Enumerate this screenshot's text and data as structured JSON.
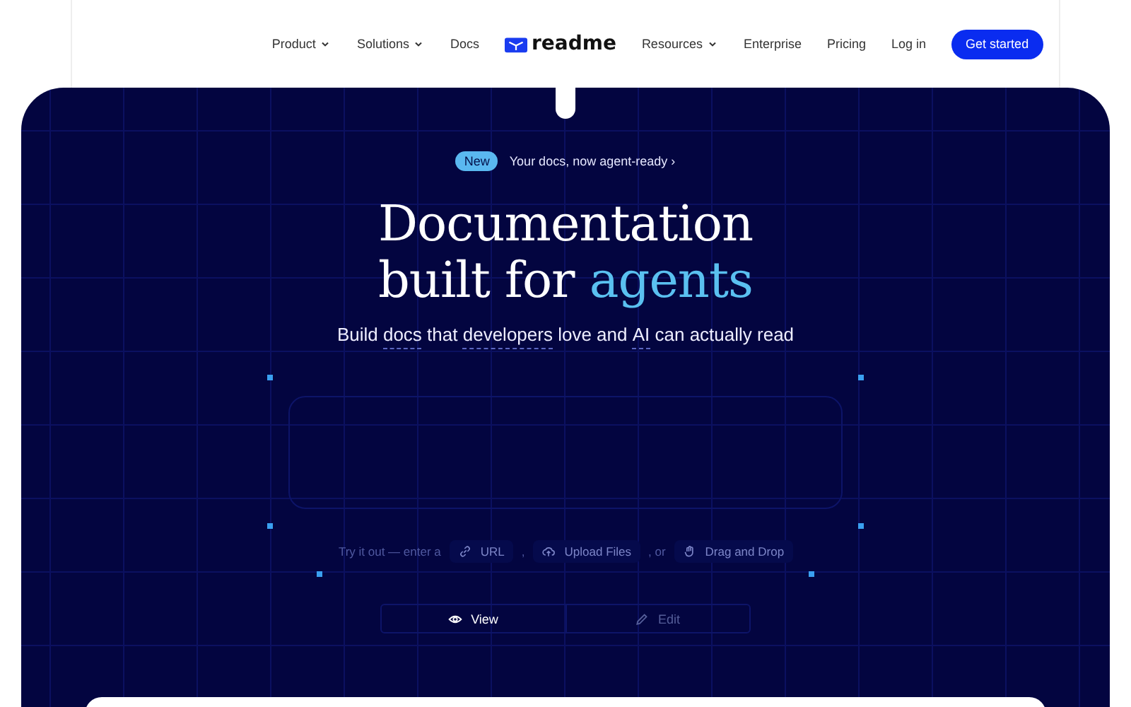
{
  "nav": {
    "left": [
      {
        "label": "Product",
        "dropdown": true
      },
      {
        "label": "Solutions",
        "dropdown": true
      },
      {
        "label": "Docs",
        "dropdown": false
      }
    ],
    "logo": "readme",
    "right": [
      {
        "label": "Resources",
        "dropdown": true
      },
      {
        "label": "Enterprise",
        "dropdown": false
      },
      {
        "label": "Pricing",
        "dropdown": false
      }
    ],
    "login": "Log in",
    "cta": "Get started"
  },
  "hero": {
    "badge": "New",
    "announcement": "Your docs, now agent-ready ›",
    "title_line1": "Documentation",
    "title_line2": "built for",
    "title_accent": "agents",
    "subtitle": [
      {
        "text": "Build ",
        "underlined": false
      },
      {
        "text": "docs",
        "underlined": true
      },
      {
        "text": " that ",
        "underlined": false
      },
      {
        "text": "developers",
        "underlined": true
      },
      {
        "text": " love and ",
        "underlined": false
      },
      {
        "text": "AI",
        "underlined": true
      },
      {
        "text": " can actually read",
        "underlined": false
      }
    ],
    "try": {
      "prompt": "Try it out — enter a",
      "options": [
        {
          "label": "URL",
          "kind": "link",
          "after": ","
        },
        {
          "label": "Upload Files",
          "kind": "upload",
          "after": ", or"
        },
        {
          "label": "Drag and Drop",
          "kind": "drag"
        }
      ]
    },
    "tabs": [
      {
        "label": "View",
        "kind": "view",
        "selected": true
      },
      {
        "label": "Edit",
        "kind": "edit",
        "selected": false
      }
    ]
  }
}
